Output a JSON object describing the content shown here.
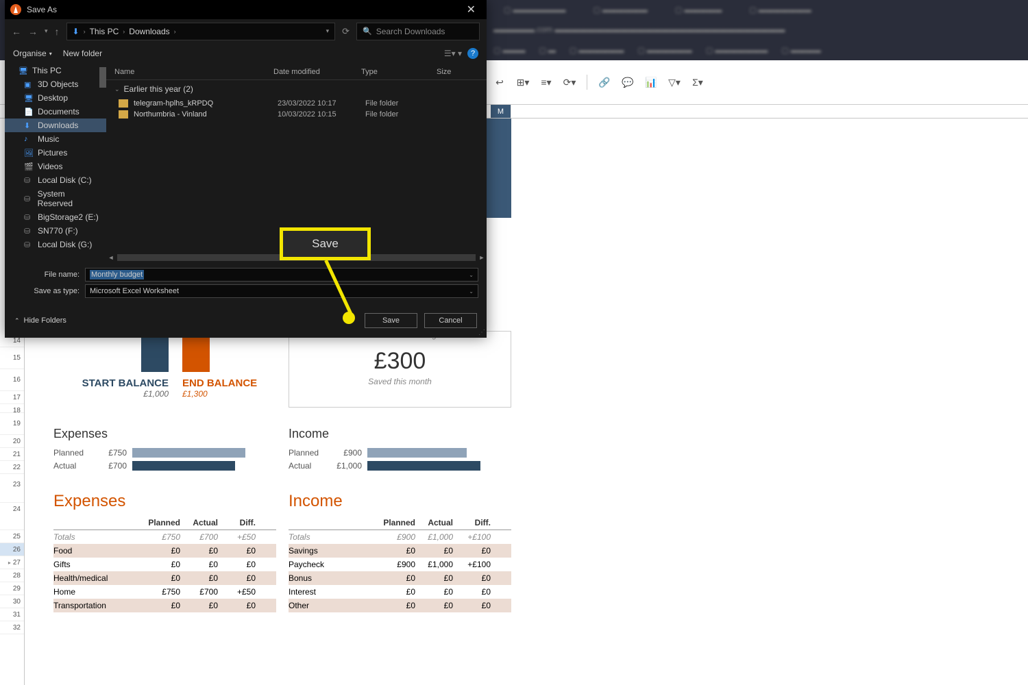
{
  "dialog": {
    "title": "Save As",
    "nav": {
      "pc": "This PC",
      "folder": "Downloads"
    },
    "search_placeholder": "Search Downloads",
    "toolbar": {
      "organise": "Organise",
      "newfolder": "New folder"
    },
    "tree": [
      {
        "label": "This PC",
        "icon": "pc",
        "root": true
      },
      {
        "label": "3D Objects",
        "icon": "3d"
      },
      {
        "label": "Desktop",
        "icon": "desktop"
      },
      {
        "label": "Documents",
        "icon": "doc"
      },
      {
        "label": "Downloads",
        "icon": "dl",
        "sel": true
      },
      {
        "label": "Music",
        "icon": "music"
      },
      {
        "label": "Pictures",
        "icon": "pic"
      },
      {
        "label": "Videos",
        "icon": "vid"
      },
      {
        "label": "Local Disk (C:)",
        "icon": "disk"
      },
      {
        "label": "System Reserved",
        "icon": "disk"
      },
      {
        "label": "BigStorage2 (E:)",
        "icon": "disk"
      },
      {
        "label": "SN770 (F:)",
        "icon": "disk"
      },
      {
        "label": "Local Disk (G:)",
        "icon": "disk"
      }
    ],
    "columns": {
      "name": "Name",
      "date": "Date modified",
      "type": "Type",
      "size": "Size"
    },
    "group": "Earlier this year (2)",
    "files": [
      {
        "name": "telegram-hplhs_kRPDQ",
        "date": "23/03/2022 10:17",
        "type": "File folder"
      },
      {
        "name": "Northumbria - Vinland",
        "date": "10/03/2022 10:15",
        "type": "File folder"
      }
    ],
    "filename_label": "File name:",
    "filename_value": "Monthly budget",
    "saveas_label": "Save as type:",
    "saveas_value": "Microsoft Excel Worksheet",
    "hide_folders": "Hide Folders",
    "save_btn": "Save",
    "cancel_btn": "Cancel"
  },
  "callout": {
    "label": "Save"
  },
  "sheet": {
    "col_m": "M",
    "start_balance": {
      "label": "START BALANCE",
      "value": "£1,000"
    },
    "end_balance": {
      "label": "END BALANCE",
      "value": "£1,300"
    },
    "saved": {
      "inc": "Increase in total savings",
      "amount": "£300",
      "sub": "Saved this month"
    },
    "expenses_sec": {
      "title": "Expenses",
      "planned_lbl": "Planned",
      "planned_val": "£750",
      "actual_lbl": "Actual",
      "actual_val": "£700"
    },
    "income_sec": {
      "title": "Income",
      "planned_lbl": "Planned",
      "planned_val": "£900",
      "actual_lbl": "Actual",
      "actual_val": "£1,000"
    },
    "expenses_tbl": {
      "title": "Expenses",
      "hdr": {
        "planned": "Planned",
        "actual": "Actual",
        "diff": "Diff."
      },
      "totals_lbl": "Totals",
      "totals": {
        "planned": "£750",
        "actual": "£700",
        "diff": "+£50"
      },
      "rows": [
        {
          "name": "Food",
          "p": "£0",
          "a": "£0",
          "d": "£0"
        },
        {
          "name": "Gifts",
          "p": "£0",
          "a": "£0",
          "d": "£0"
        },
        {
          "name": "Health/medical",
          "p": "£0",
          "a": "£0",
          "d": "£0"
        },
        {
          "name": "Home",
          "p": "£750",
          "a": "£700",
          "d": "+£50"
        },
        {
          "name": "Transportation",
          "p": "£0",
          "a": "£0",
          "d": "£0"
        }
      ]
    },
    "income_tbl": {
      "title": "Income",
      "hdr": {
        "planned": "Planned",
        "actual": "Actual",
        "diff": "Diff."
      },
      "totals_lbl": "Totals",
      "totals": {
        "planned": "£900",
        "actual": "£1,000",
        "diff": "+£100"
      },
      "rows": [
        {
          "name": "Savings",
          "p": "£0",
          "a": "£0",
          "d": "£0"
        },
        {
          "name": "Paycheck",
          "p": "£900",
          "a": "£1,000",
          "d": "+£100"
        },
        {
          "name": "Bonus",
          "p": "£0",
          "a": "£0",
          "d": "£0"
        },
        {
          "name": "Interest",
          "p": "£0",
          "a": "£0",
          "d": "£0"
        },
        {
          "name": "Other",
          "p": "£0",
          "a": "£0",
          "d": "£0"
        }
      ]
    },
    "rownums": [
      "14",
      "15",
      "16",
      "17",
      "18",
      "19",
      "20",
      "21",
      "22",
      "23",
      "24",
      "25",
      "26",
      "27",
      "28",
      "29",
      "30",
      "31",
      "32"
    ]
  }
}
